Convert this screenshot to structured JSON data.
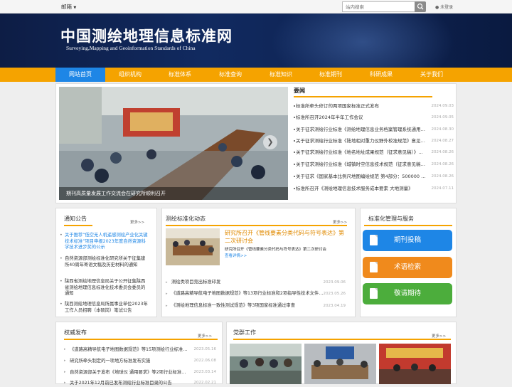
{
  "topbar": {
    "mailbox": "邮箱",
    "search_placeholder": "站内搜索",
    "login": "未登录"
  },
  "header": {
    "title": "中国测绘地理信息标准网",
    "subtitle": "Surveying,Mapping and Geoinformation Standards of China"
  },
  "nav": [
    "网站首页",
    "组织机构",
    "标准体系",
    "标准查询",
    "标准知识",
    "标准期刊",
    "科研成果",
    "关于我们"
  ],
  "slider": {
    "caption": "期刊高质量发展工作交流会在研究所顺利召开"
  },
  "news": {
    "title": "要闻",
    "items": [
      {
        "text": "标准所牵头修订的两项国家标准正式发布",
        "date": "2024.09.03"
      },
      {
        "text": "标准所召开2024年半年工作会议",
        "date": "2024.09.05"
      },
      {
        "text": "关于征求测绘行业标准《测绘地理信息业务档案管理系统通用要求》意见的通知",
        "date": "2024.08.30"
      },
      {
        "text": "关于征求测绘行业标准《陆地相对重力仪野外校准规范》意见的通知",
        "date": "2024.08.27"
      },
      {
        "text": "关于征求测绘行业标准《地名地址成果规范（征求意见稿）》意见的通知",
        "date": "2024.08.26"
      },
      {
        "text": "关于征求测绘行业标准《城镇时空信息技术规范（征求意见稿）》意见的通知",
        "date": "2024.08.26"
      },
      {
        "text": "关于征求《国家基本比例尺地图编绘规范 第4部分：500000 1:1000000地形图》意见的通知",
        "date": "2024.08.26"
      },
      {
        "text": "标准所召开《测绘地理信息技术服务成本要素 大地测量》",
        "date": "2024.07.11"
      }
    ]
  },
  "notice": {
    "title": "通知公告",
    "more": "更多>>",
    "items": [
      "关于推荐“低空无人机遥感测绘产业化关键技术标准”项目申报2023年度自然资源科学技术进步奖的公示",
      "自然资源部测绘标准化研究所关于征集建所40周年寄语文稿及历史材料的通知",
      "陕西省测绘地理信息局关于公开征集陕西省测绘地理信息标准化技术委员会委员的通知",
      "陕西测绘地理信息局所属事业单位2023年工作人员招聘（本硕岗）笔试公告"
    ]
  },
  "std_news": {
    "title": "测绘标准化动态",
    "more": "更多>>",
    "feature_title": "研究所召开《管线要素分类代码与符号表达》第二次研讨会",
    "feature_desc": "研究所召开《管线要素分类代码与符号表达》第二次研讨会",
    "feature_more": "查看详情>>",
    "items": [
      {
        "text": "测绘类项目竞出标准印发",
        "date": "2023.09.06"
      },
      {
        "text": "《道路高精导航电子地图数据规范》等13项行业标准和2项指导性技术文件发布",
        "date": "2023.05.26"
      },
      {
        "text": "《测绘地理信息标准一致性测试规范》等3项国家标准通过审查",
        "date": "2023.04.19"
      }
    ]
  },
  "services": {
    "title": "标准化管理与服务",
    "buttons": [
      {
        "label": "期刊投稿",
        "color": "#1e86e6"
      },
      {
        "label": "术语检索",
        "color": "#f08a1c"
      },
      {
        "label": "敬请期待",
        "color": "#4cad3c"
      }
    ]
  },
  "authority": {
    "title": "权威发布",
    "more": "更多>>",
    "items": [
      {
        "text": "《道路高精导航电子地图数据规范》等15项测绘行业标准发布",
        "date": "2023.05.16"
      },
      {
        "text": "研究所牵头制定的一项地方标准发布实施",
        "date": "2022.06.08"
      },
      {
        "text": "自然资源部关于发布《地球仪 通用要求》等2项行业标准的公告",
        "date": "2023.03.14"
      },
      {
        "text": "关于2021年12月前已发布测绘行业标准目录的公告",
        "date": "2022.02.21"
      }
    ]
  },
  "party": {
    "title": "党群工作",
    "more": "更多>>"
  }
}
